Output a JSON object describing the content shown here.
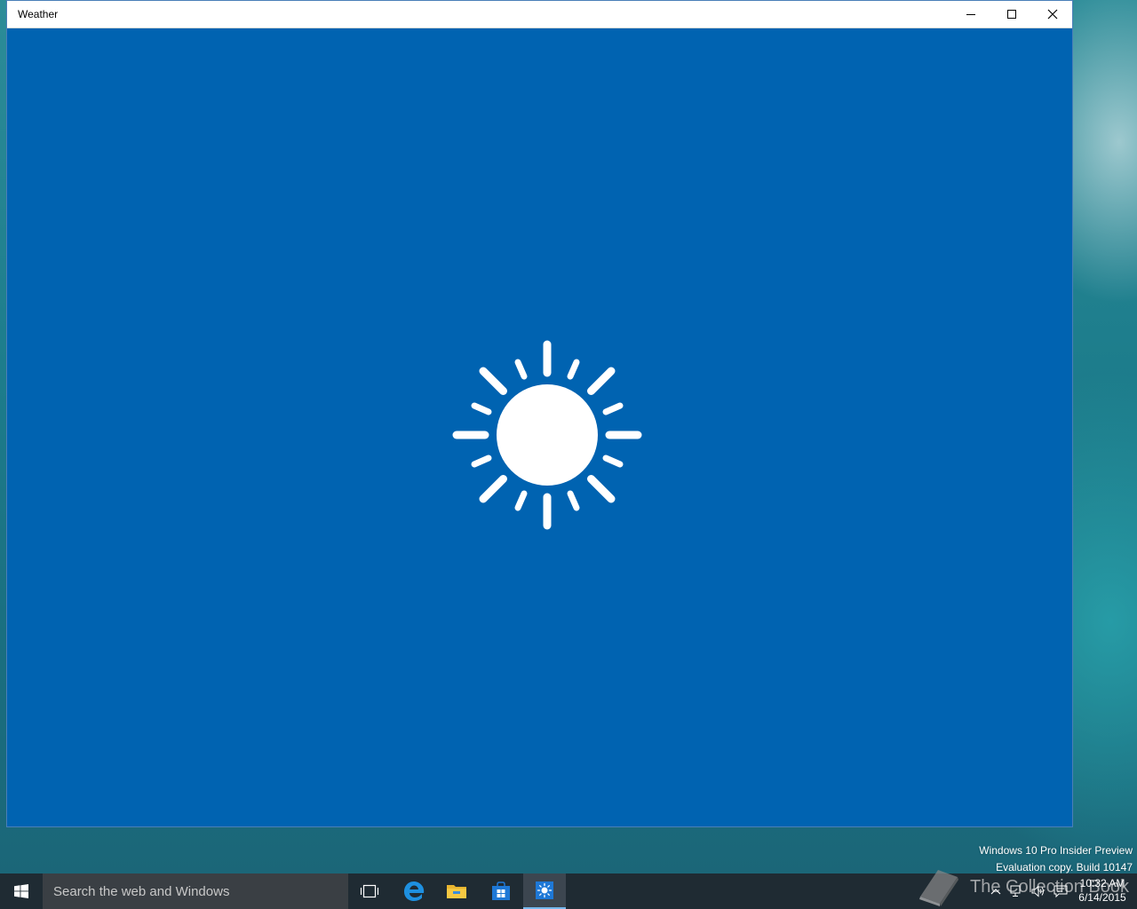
{
  "window": {
    "title": "Weather"
  },
  "splash": {
    "icon": "sun-icon"
  },
  "watermark": {
    "line1": "Windows 10 Pro Insider Preview",
    "line2": "Evaluation copy. Build 10147"
  },
  "taskbar": {
    "search_placeholder": "Search the web and Windows",
    "pinned": [
      "task-view-icon",
      "edge-icon",
      "file-explorer-icon",
      "store-icon",
      "weather-app-icon"
    ]
  },
  "tray": {
    "time": "10:32 AM",
    "date": "6/14/2015"
  },
  "brand": {
    "text": "The Collection Book"
  },
  "colors": {
    "app_background": "#0063b1",
    "taskbar": "#1f2b33",
    "accent": "#76b9ed"
  }
}
